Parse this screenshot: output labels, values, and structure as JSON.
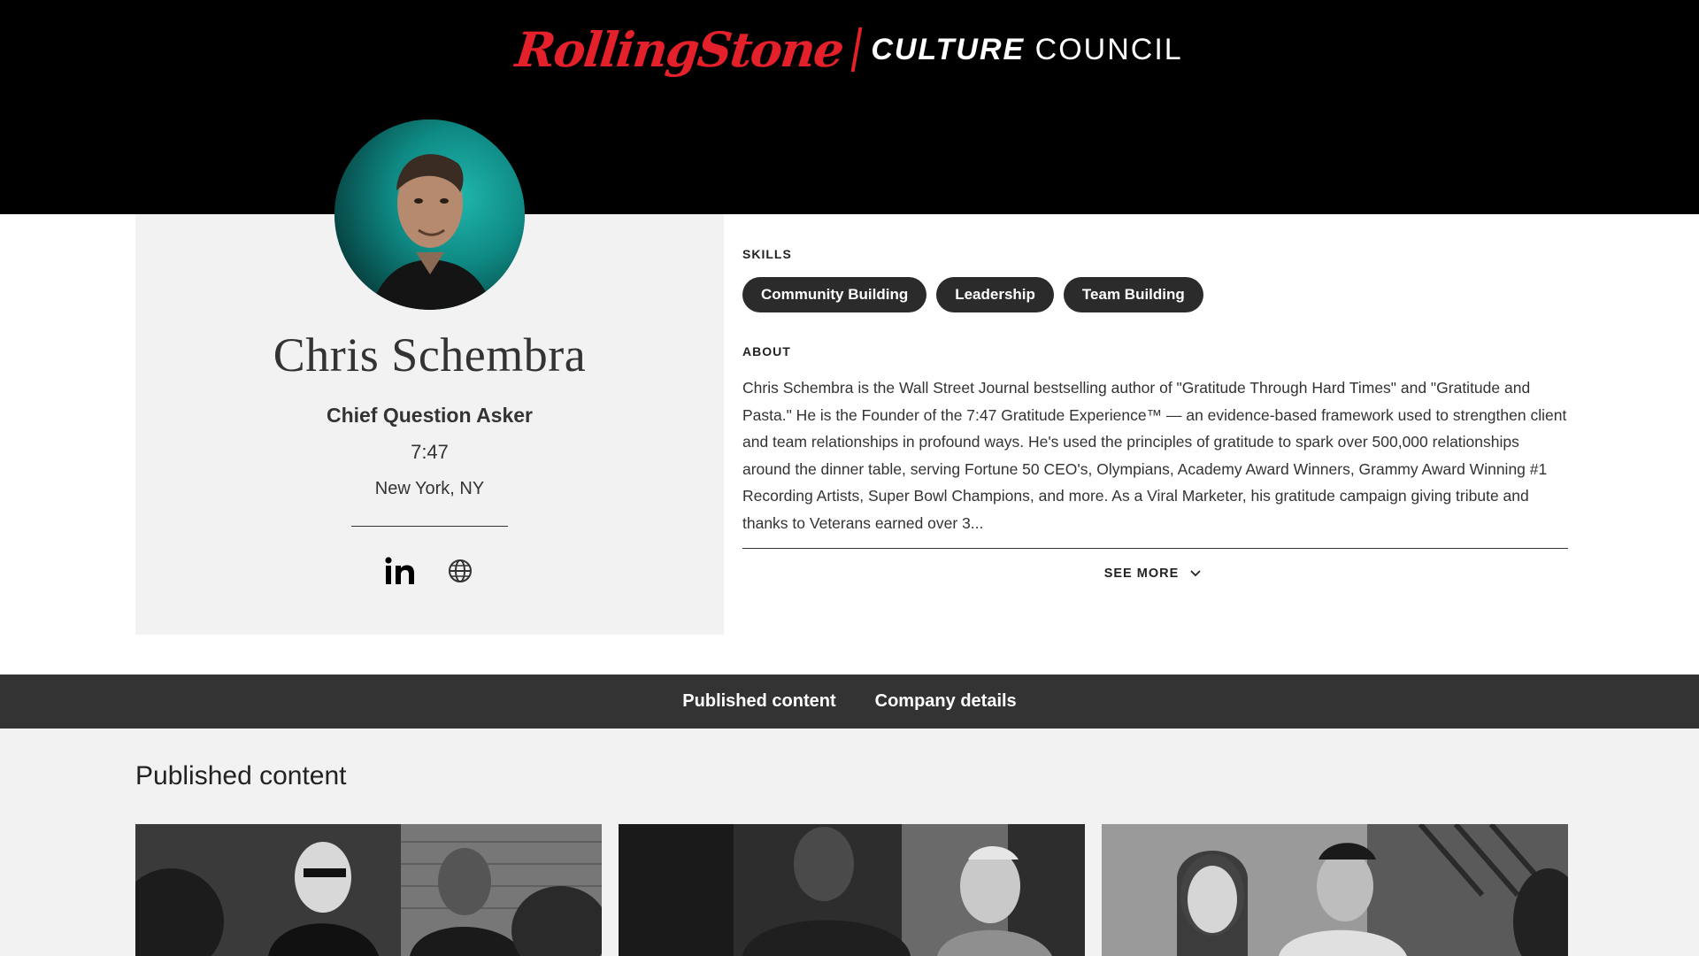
{
  "brand": {
    "logo_text": "RollingStone",
    "sub_bold": "CULTURE",
    "sub_light": "COUNCIL"
  },
  "profile": {
    "name": "Chris Schembra",
    "role": "Chief Question Asker",
    "company": "7:47",
    "location": "New York, NY",
    "socials": [
      {
        "icon": "linkedin-icon",
        "label": "in"
      },
      {
        "icon": "globe-icon"
      }
    ]
  },
  "skills": {
    "label": "SKILLS",
    "items": [
      "Community Building",
      "Leadership",
      "Team Building"
    ]
  },
  "about": {
    "label": "ABOUT",
    "text": "Chris Schembra is the Wall Street Journal bestselling author of \"Gratitude Through Hard Times\" and \"Gratitude and Pasta.\" He is the Founder of the 7:47 Gratitude Experience™ — an evidence-based framework used to strengthen client and team relationships in profound ways. He's used the principles of gratitude to spark over 500,000 relationships around the dinner table, serving Fortune 50 CEO's, Olympians, Academy Award Winners, Grammy Award Winning #1 Recording Artists, Super Bowl Champions, and more. As a Viral Marketer, his gratitude campaign giving tribute and thanks to Veterans earned over 3...",
    "see_more": "SEE MORE"
  },
  "tabs": [
    "Published content",
    "Company details"
  ],
  "published": {
    "title": "Published content"
  },
  "colors": {
    "header_bg": "#000000",
    "brand_red": "#e4202b",
    "card_bg": "#f2f2f2",
    "pill_bg": "#2b2b2b",
    "tabbar_bg": "#333333"
  }
}
